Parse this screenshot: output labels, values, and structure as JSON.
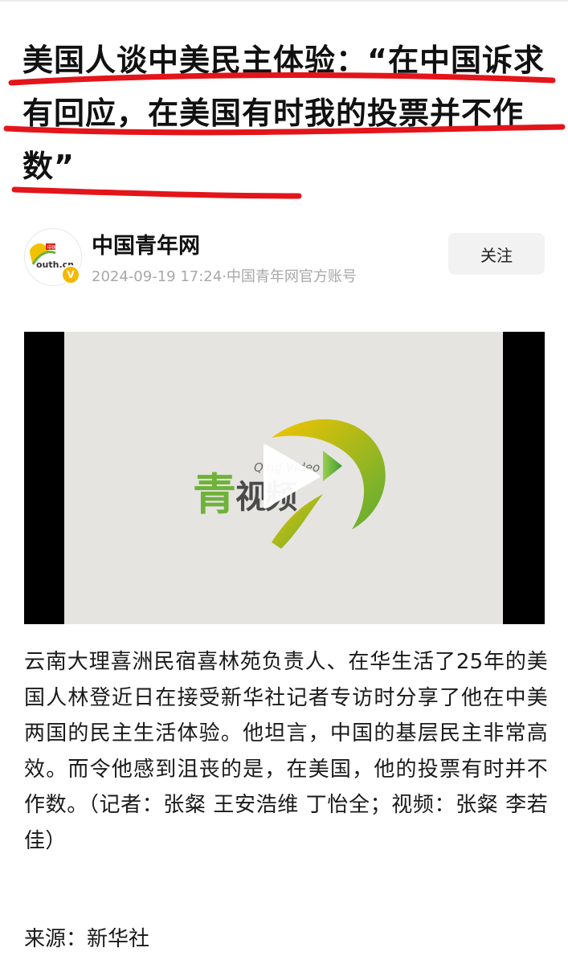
{
  "article": {
    "title": "美国人谈中美民主体验：“在中国诉求有回应，在美国有时我的投票并不作数”",
    "body": "云南大理喜洲民宿喜林苑负责人、在华生活了25年的美国人林登近日在接受新华社记者专访时分享了他在中美两国的民主生活体验。他坦言，中国的基层民主非常高效。而令他感到沮丧的是，在美国，他的投票有时并不作数。（记者：张粲 王安浩维 丁怡全；视频：张粲 李若佳）",
    "source": "来源：新华社"
  },
  "author": {
    "name": "中国青年网",
    "meta": "2024-09-19 17:24·中国青年网官方账号",
    "avatar_text_top": "中国青年网",
    "avatar_text_bottom": "outh.cn",
    "verified_mark": "V",
    "follow_label": "关注"
  },
  "video": {
    "logo_cn_1": "青",
    "logo_cn_2": "视频",
    "logo_latin": "Qing Video"
  },
  "colors": {
    "annotation_underline": "#e3151a",
    "logo_green": "#6fb23a",
    "logo_yellow": "#f2c200",
    "video_letterbox": "#000000",
    "video_background": "#e5e4e1"
  },
  "icons": {
    "play": "play-icon",
    "verified": "verified-badge-icon"
  }
}
